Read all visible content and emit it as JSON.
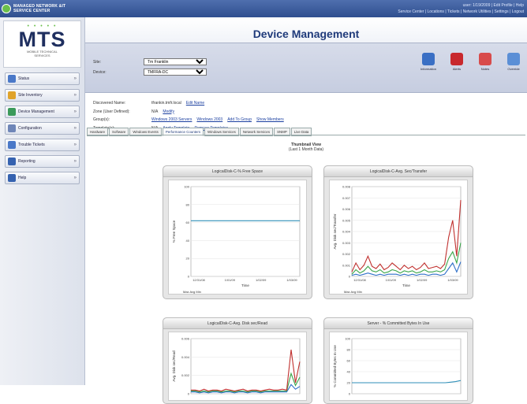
{
  "brand": {
    "line1": "MANAGED NETWORK &IT",
    "line2": "SERVICE CENTER"
  },
  "top_links": {
    "user_line": "user: 1/19/2009 | Edit Profile | Help",
    "nav_line": "Service Center | Locations | Tickets | Network Utilities | Settings | Logout"
  },
  "logo": {
    "dots": "• • • • •",
    "name": "MTS",
    "sub1": "MOBILE TECHNICAL",
    "sub2": "SERVICES"
  },
  "nav": [
    {
      "label": "Status",
      "color": "#4a78c8"
    },
    {
      "label": "Site Inventory",
      "color": "#e0a32a"
    },
    {
      "label": "Device Management",
      "color": "#3b9a5a"
    },
    {
      "label": "Configuration",
      "color": "#6f86b8"
    },
    {
      "label": "Trouble Tickets",
      "color": "#4a78c8"
    },
    {
      "label": "Reporting",
      "color": "#3562b0"
    },
    {
      "label": "Help",
      "color": "#3562b0"
    }
  ],
  "page_title": "Device Management",
  "filters": {
    "site_label": "Site:",
    "site_value": "Tm Franklin",
    "device_label": "Device:",
    "device_value": "TMFRA-DC"
  },
  "tools": [
    {
      "label": "Information",
      "color": "#3a6fc4"
    },
    {
      "label": "Alerts",
      "color": "#c8282d"
    },
    {
      "label": "Notes",
      "color": "#d84b4b"
    },
    {
      "label": "Override",
      "color": "#5b8fd6"
    }
  ],
  "props": [
    {
      "key": "Discovered Name:",
      "value": "tfrankin.tmfr.local",
      "link": "Edit Name"
    },
    {
      "key": "Zone (User Defined):",
      "value": "N/A",
      "link": "Modify"
    },
    {
      "key": "Group(s):",
      "value": "",
      "links": [
        "Windows 2003 Servers",
        "Windows 2003",
        "Add To Group",
        "Show Members"
      ]
    },
    {
      "key": "Template(s):",
      "value": "N/A",
      "links": [
        "Apply Template",
        "Remove Templates"
      ]
    }
  ],
  "tabs": [
    "Hardware",
    "Software",
    "Windows Events",
    "Performance Counters",
    "Windows Services",
    "Network Services",
    "SNMP",
    "Live Data"
  ],
  "active_tab": 3,
  "view": {
    "line1": "Thumbnail View",
    "line2": "(Last 1 Month Data)"
  },
  "charts": [
    {
      "title": "LogicalDisk-C-% Free Space",
      "ylabel": "% Free Space",
      "xlabel": "Time",
      "legend": "Max Avg Min",
      "yticks": [
        "100",
        "80",
        "60",
        "40",
        "20",
        "0"
      ],
      "xticks": [
        "12/31/08",
        "1/01/09",
        "1/02/09",
        "1/03/09"
      ]
    },
    {
      "title": "LogicalDisk-C-Avg. Sec/Transfer",
      "ylabel": "Avg. Disk sec/Transfer",
      "xlabel": "Time",
      "legend": "Max Avg Min",
      "yticks": [
        "0.008",
        "0.007",
        "0.006",
        "0.005",
        "0.004",
        "0.003",
        "0.002",
        "0.001",
        "0"
      ],
      "xticks": [
        "12/31/08",
        "1/01/09",
        "1/02/09",
        "1/03/09"
      ]
    },
    {
      "title": "LogicalDisk-C-Avg. Disk sec/Read",
      "ylabel": "Avg. Disk sec/Read",
      "xlabel": "Time",
      "legend": "",
      "yticks": [
        "0.006",
        "0.004",
        "0.002",
        "0"
      ],
      "xticks": [
        "12/31/08",
        "1/01/09",
        "1/02/09",
        "1/03/09"
      ]
    },
    {
      "title": "Server - % Committed Bytes In Use",
      "ylabel": "% Committed Bytes In Use",
      "xlabel": "Time",
      "legend": "",
      "yticks": [
        "100",
        "80",
        "60",
        "40",
        "20",
        "0"
      ],
      "xticks": [
        "12/31/08",
        "1/01/09",
        "1/02/09",
        "1/03/09"
      ]
    }
  ],
  "chart_data": [
    {
      "type": "line",
      "title": "LogicalDisk-C-% Free Space",
      "ylim": [
        0,
        100
      ],
      "series": [
        {
          "name": "Max",
          "values": [
            62,
            62,
            62,
            62,
            62,
            62,
            62,
            62,
            62,
            62,
            62,
            62
          ]
        }
      ]
    },
    {
      "type": "line",
      "title": "LogicalDisk-C-Avg. Sec/Transfer",
      "ylim": [
        0,
        0.008
      ],
      "series": [
        {
          "name": "Max",
          "values": [
            0.0004,
            0.0012,
            0.0006,
            0.001,
            0.0018,
            0.0009,
            0.0007,
            0.0011,
            0.0006,
            0.0008,
            0.0012,
            0.0009,
            0.0006,
            0.001,
            0.0007,
            0.0009,
            0.0006,
            0.0008,
            0.0012,
            0.0007,
            0.0008,
            0.0009,
            0.0007,
            0.0011,
            0.0035,
            0.005,
            0.0018,
            0.0068
          ]
        },
        {
          "name": "Avg",
          "values": [
            0.0002,
            0.0006,
            0.0003,
            0.0005,
            0.0009,
            0.0005,
            0.0004,
            0.0006,
            0.0003,
            0.0004,
            0.0006,
            0.0005,
            0.0003,
            0.0005,
            0.0004,
            0.0005,
            0.0003,
            0.0004,
            0.0006,
            0.0004,
            0.0004,
            0.0005,
            0.0004,
            0.0006,
            0.0016,
            0.0022,
            0.0012,
            0.003
          ]
        },
        {
          "name": "Min",
          "values": [
            0.0001,
            0.0002,
            0.0001,
            0.0002,
            0.0003,
            0.0002,
            0.0001,
            0.0002,
            0.0001,
            0.0002,
            0.0002,
            0.0002,
            0.0001,
            0.0002,
            0.0001,
            0.0002,
            0.0001,
            0.0002,
            0.0002,
            0.0001,
            0.0002,
            0.0002,
            0.0001,
            0.0002,
            0.0007,
            0.0012,
            0.0004,
            0.0013
          ]
        }
      ]
    },
    {
      "type": "line",
      "title": "LogicalDisk-C-Avg. Disk sec/Read",
      "ylim": [
        0,
        0.006
      ],
      "series": [
        {
          "name": "Max",
          "values": [
            0.0004,
            0.0004,
            0.0003,
            0.0005,
            0.0003,
            0.0004,
            0.0004,
            0.0003,
            0.0005,
            0.0004,
            0.0003,
            0.0004,
            0.0005,
            0.0003,
            0.0004,
            0.0004,
            0.0003,
            0.0004,
            0.0005,
            0.0004,
            0.0004,
            0.0005,
            0.0004,
            0.0048,
            0.0012,
            0.0035
          ]
        },
        {
          "name": "Avg",
          "values": [
            0.0003,
            0.0003,
            0.0002,
            0.0003,
            0.0002,
            0.0003,
            0.0003,
            0.0002,
            0.0003,
            0.0003,
            0.0002,
            0.0003,
            0.0003,
            0.0002,
            0.0003,
            0.0003,
            0.0002,
            0.0003,
            0.0003,
            0.0003,
            0.0003,
            0.0003,
            0.0003,
            0.0022,
            0.0009,
            0.0018
          ]
        },
        {
          "name": "Min",
          "values": [
            0.0002,
            0.0002,
            0.0001,
            0.0002,
            0.0001,
            0.0002,
            0.0002,
            0.0001,
            0.0002,
            0.0002,
            0.0001,
            0.0002,
            0.0002,
            0.0001,
            0.0002,
            0.0002,
            0.0001,
            0.0002,
            0.0002,
            0.0002,
            0.0002,
            0.0002,
            0.0002,
            0.001,
            0.0005,
            0.0008
          ]
        }
      ]
    },
    {
      "type": "line",
      "title": "Server - % Committed Bytes In Use",
      "ylim": [
        0,
        100
      ],
      "series": [
        {
          "name": "Max",
          "values": [
            20,
            20,
            20,
            20,
            20,
            20,
            20,
            20,
            20,
            20,
            20,
            20,
            20,
            20,
            20,
            20,
            20,
            20,
            20,
            21,
            22,
            24
          ]
        }
      ]
    }
  ],
  "colors": {
    "max": "#c0302e",
    "avg": "#3aa64a",
    "min": "#2f70c9"
  }
}
